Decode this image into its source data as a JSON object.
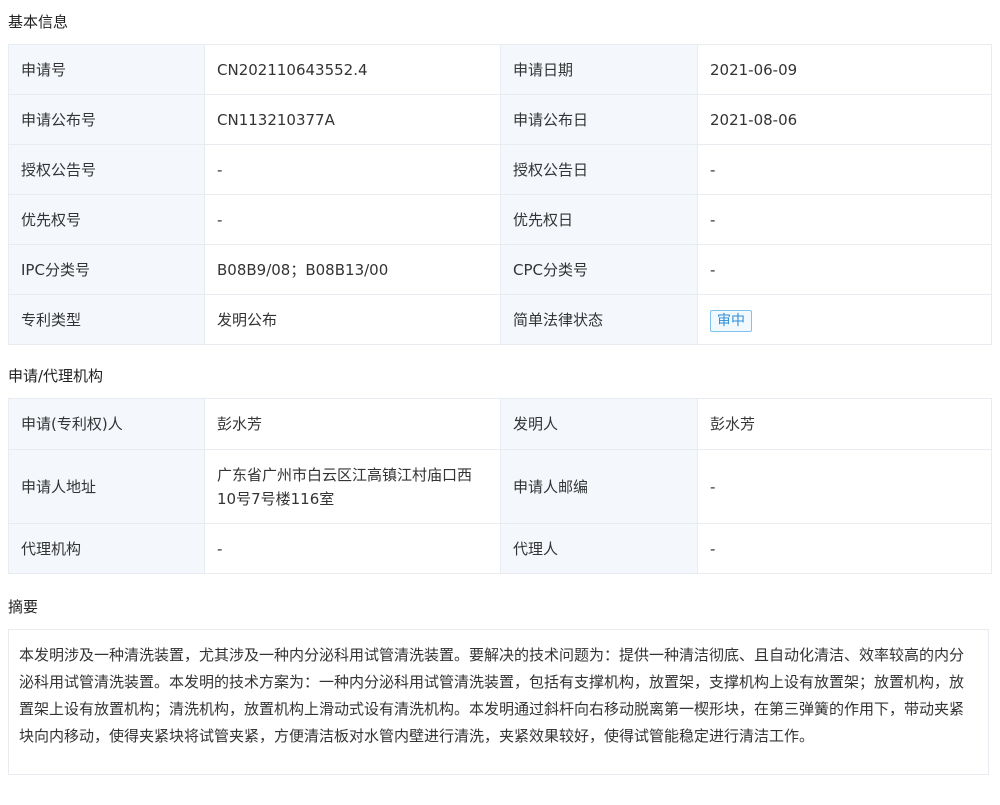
{
  "sections": {
    "basic": "基本信息",
    "agent": "申请/代理机构",
    "abstract": "摘要"
  },
  "basic": [
    {
      "l1": "申请号",
      "v1": "CN202110643552.4",
      "l2": "申请日期",
      "v2": "2021-06-09"
    },
    {
      "l1": "申请公布号",
      "v1": "CN113210377A",
      "l2": "申请公布日",
      "v2": "2021-08-06"
    },
    {
      "l1": "授权公告号",
      "v1": "-",
      "l2": "授权公告日",
      "v2": "-"
    },
    {
      "l1": "优先权号",
      "v1": "-",
      "l2": "优先权日",
      "v2": "-"
    },
    {
      "l1": "IPC分类号",
      "v1": "B08B9/08；B08B13/00",
      "l2": "CPC分类号",
      "v2": "-"
    },
    {
      "l1": "专利类型",
      "v1": "发明公布",
      "l2": "简单法律状态",
      "v2": "审中"
    }
  ],
  "agent": [
    {
      "l1": "申请(专利权)人",
      "v1": "彭水芳",
      "l2": "发明人",
      "v2": "彭水芳"
    },
    {
      "l1": "申请人地址",
      "v1": "广东省广州市白云区江高镇江村庙口西10号7号楼116室",
      "l2": "申请人邮编",
      "v2": "-"
    },
    {
      "l1": "代理机构",
      "v1": "-",
      "l2": "代理人",
      "v2": "-"
    }
  ],
  "abstract_text": "本发明涉及一种清洗装置，尤其涉及一种内分泌科用试管清洗装置。要解决的技术问题为：提供一种清洁彻底、且自动化清洁、效率较高的内分泌科用试管清洗装置。本发明的技术方案为：一种内分泌科用试管清洗装置，包括有支撑机构，放置架，支撑机构上设有放置架；放置机构，放置架上设有放置机构；清洗机构，放置机构上滑动式设有清洗机构。本发明通过斜杆向右移动脱离第一楔形块，在第三弹簧的作用下，带动夹紧块向内移动，使得夹紧块将试管夹紧，方便清洁板对水管内壁进行清洗，夹紧效果较好，使得试管能稳定进行清洁工作。"
}
